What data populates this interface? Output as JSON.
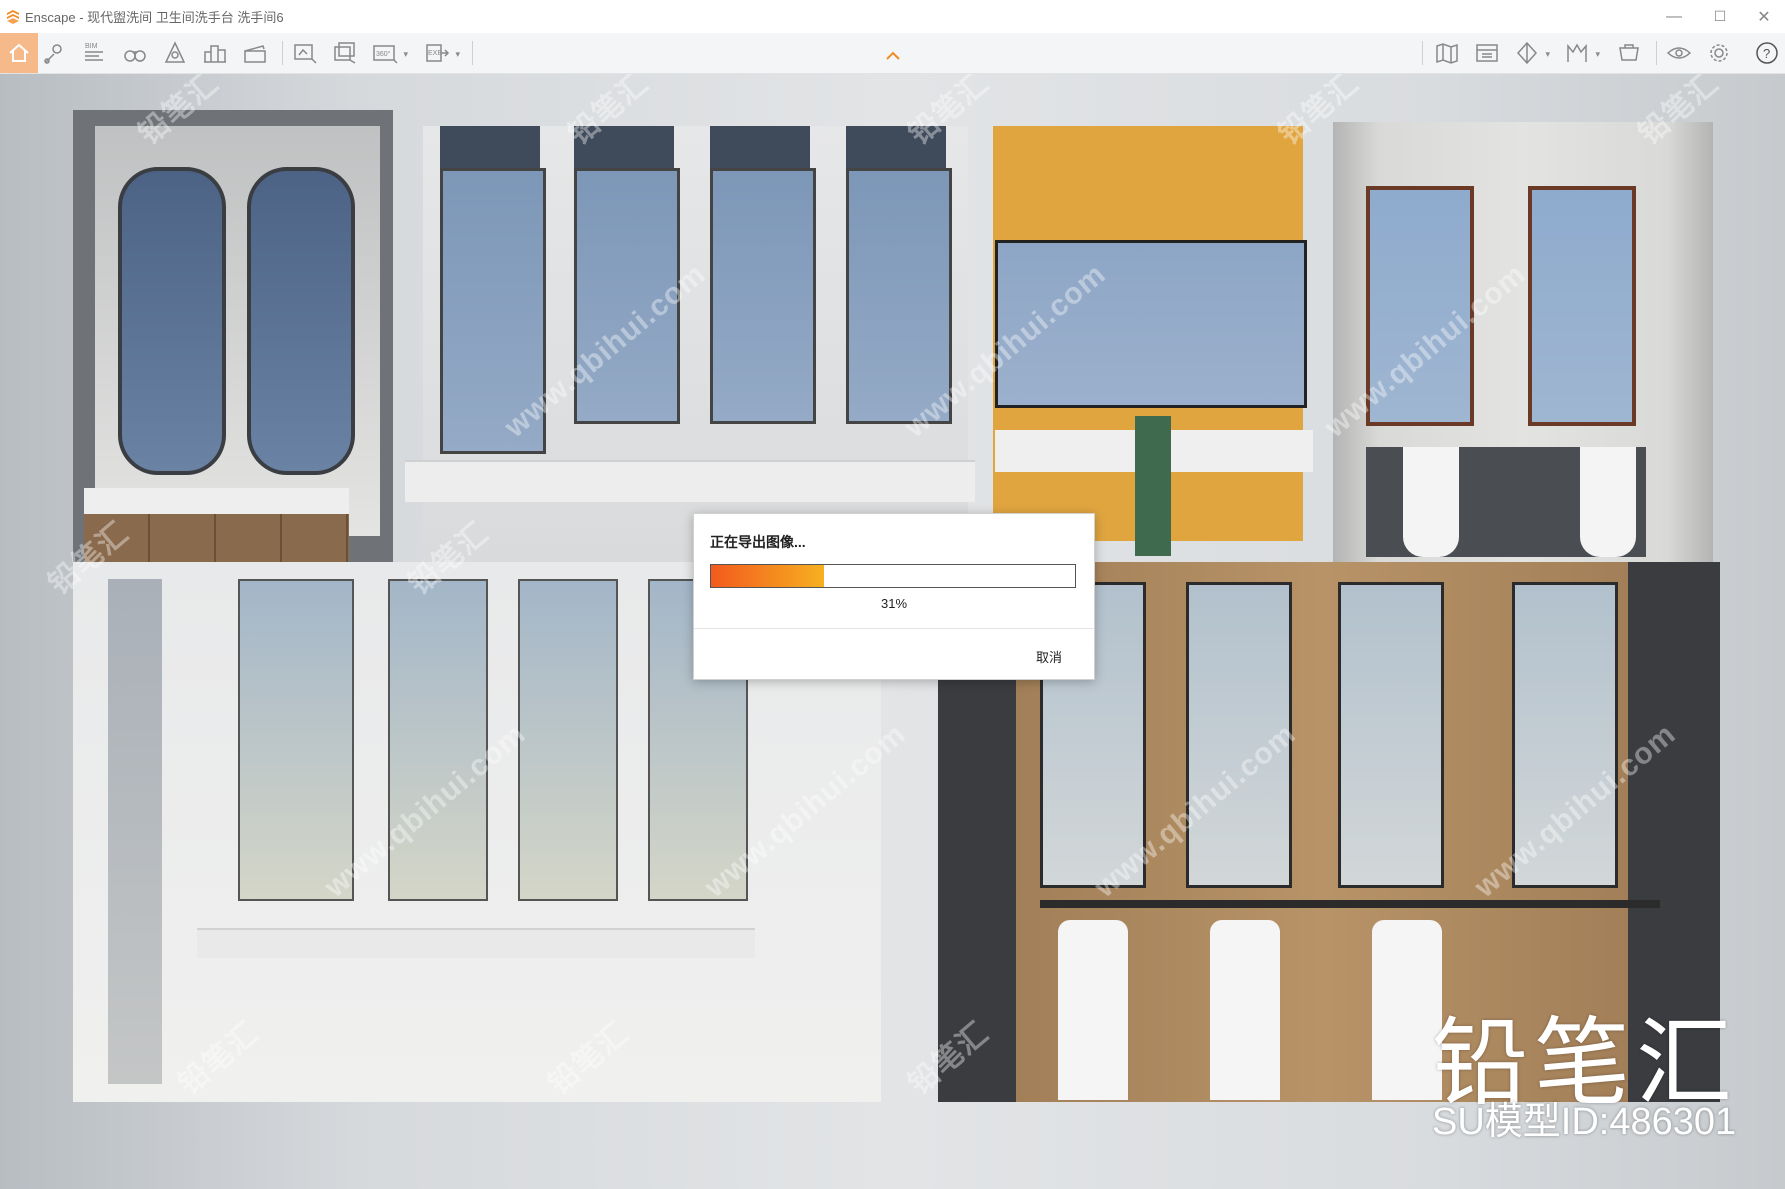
{
  "app": {
    "name": "Enscape",
    "window_title": "Enscape - 现代盥洗间 卫生间洗手台 洗手间6"
  },
  "window_controls": {
    "minimize": "—",
    "maximize": "☐",
    "close": "✕"
  },
  "toolbar": {
    "left_icons": [
      "home-icon",
      "location-pin-icon",
      "bim-icon",
      "binoculars-icon",
      "compass-icon",
      "buildings-icon",
      "clapboard-icon",
      "screenshot-icon",
      "batch-render-icon",
      "panorama-360-icon",
      "export-exe-icon"
    ],
    "right_icons": [
      "map-icon",
      "panel-icon",
      "section-icon",
      "materials-icon",
      "asset-library-icon",
      "visibility-icon",
      "settings-icon",
      "help-icon"
    ],
    "bim_label": "BIM",
    "pano_label": "360°",
    "exe_label": "EXE",
    "accent_color": "#f08a24",
    "home_bg": "#f6b98a"
  },
  "dialog": {
    "title": "正在导出图像...",
    "progress": 0.31,
    "progress_text": "31%",
    "cancel_label": "取消"
  },
  "watermark": {
    "brand": "铅笔汇",
    "model_id": "SU模型ID:486301",
    "diagonal_text": "www.qbihui.com",
    "diagonal_logo": "铅笔汇"
  }
}
